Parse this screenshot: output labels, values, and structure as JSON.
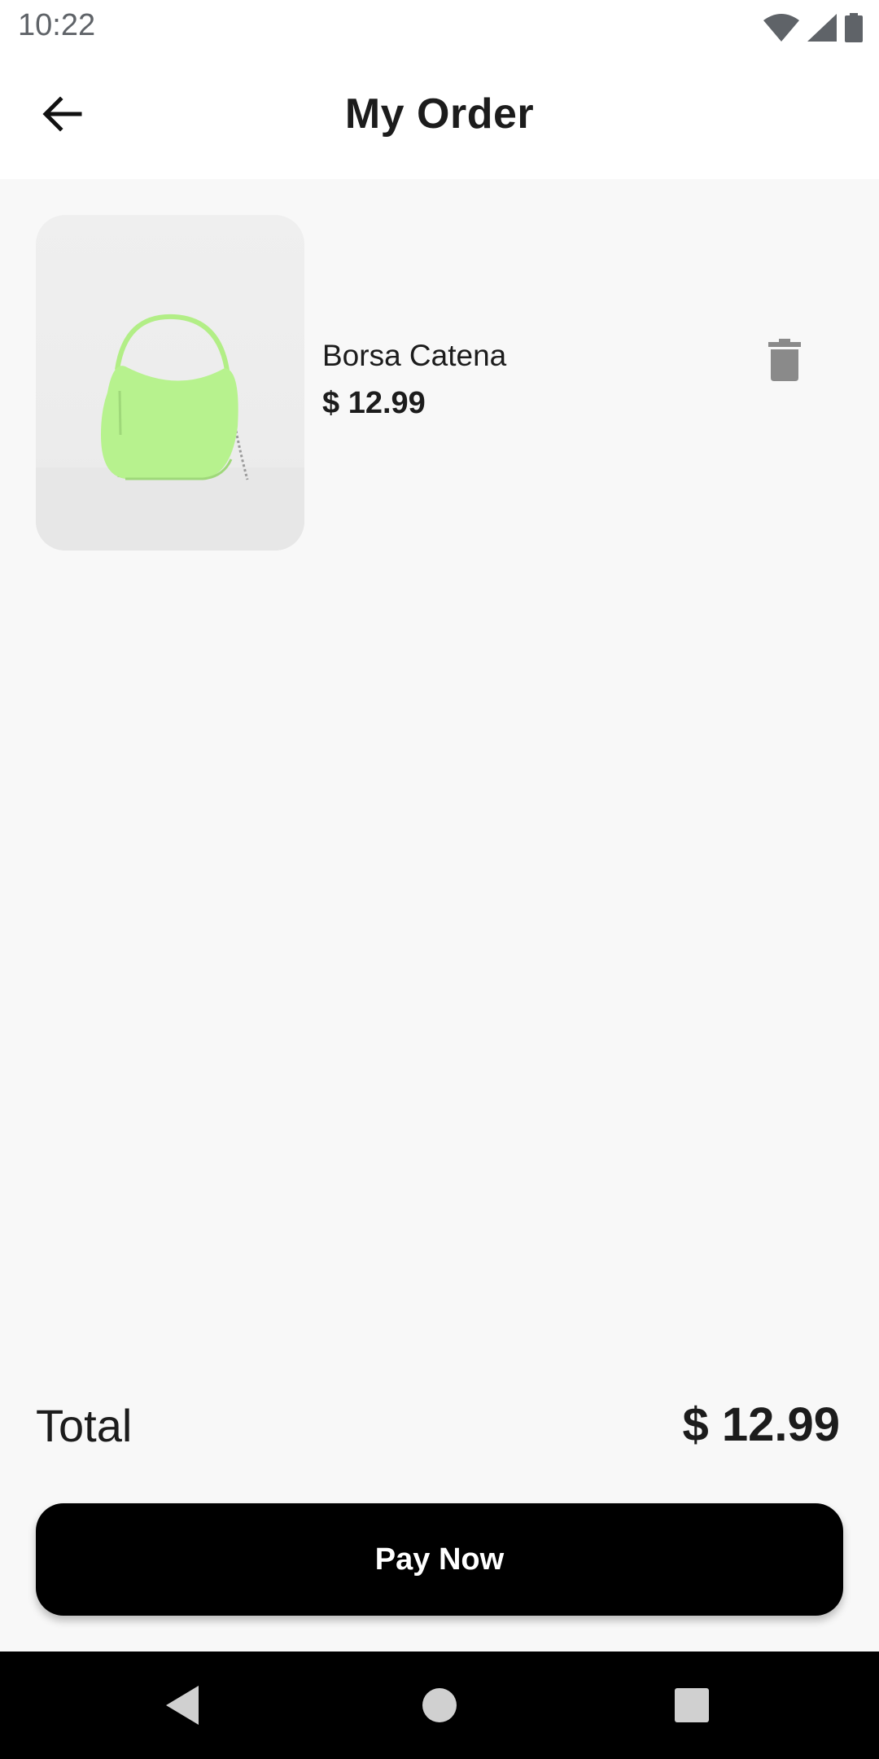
{
  "status_bar": {
    "time": "10:22",
    "icons": [
      "wifi-icon",
      "cell-signal-icon",
      "battery-icon"
    ]
  },
  "app_bar": {
    "title": "My Order",
    "back_icon": "arrow-left-icon"
  },
  "order_items": [
    {
      "name": "Borsa Catena",
      "price": "$ 12.99",
      "image": "green-handbag",
      "delete_icon": "trash-icon"
    }
  ],
  "summary": {
    "total_label": "Total",
    "total_value": "$ 12.99"
  },
  "pay_button": {
    "label": "Pay Now"
  },
  "nav_bar": {
    "icons": [
      "nav-back-icon",
      "nav-home-icon",
      "nav-recents-icon"
    ]
  },
  "colors": {
    "background": "#f8f8f8",
    "primary_button": "#000000",
    "icon_gray": "#8a8a8a",
    "product_accent": "#b5f28c"
  }
}
